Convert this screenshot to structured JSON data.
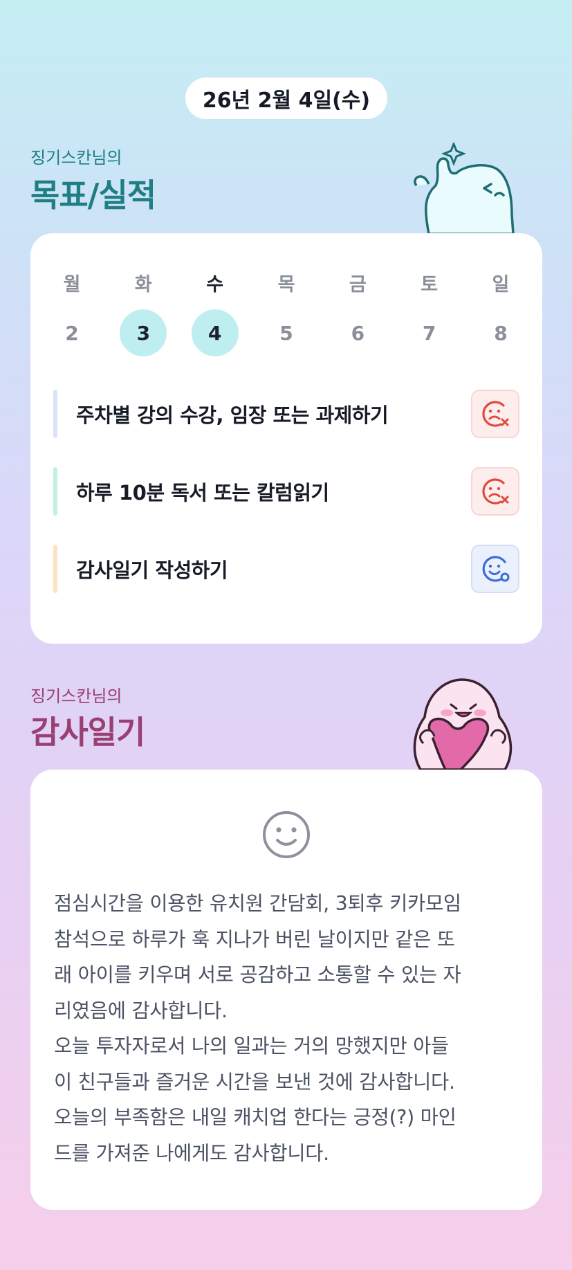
{
  "header": {
    "date": "26년 2월 4일(수)"
  },
  "goals_section": {
    "subtitle": "징기스칸님의",
    "title": "목표/실적",
    "week": {
      "days": [
        "월",
        "화",
        "수",
        "목",
        "금",
        "토",
        "일"
      ],
      "dates": [
        "2",
        "3",
        "4",
        "5",
        "6",
        "7",
        "8"
      ],
      "highlighted": [
        "3",
        "4"
      ],
      "today": "4"
    },
    "goals": [
      {
        "text": "주차별 강의 수강, 임장 또는 과제하기",
        "accent": "#dbe2fb",
        "status": "fail",
        "status_icon": "sad-face-x-icon"
      },
      {
        "text": "하루 10분 독서 또는 칼럼읽기",
        "accent": "#c4f0df",
        "status": "fail",
        "status_icon": "sad-face-x-icon"
      },
      {
        "text": "감사일기 작성하기",
        "accent": "#fde2c2",
        "status": "done",
        "status_icon": "smile-face-check-icon"
      }
    ]
  },
  "diary_section": {
    "subtitle": "징기스칸님의",
    "title": "감사일기",
    "mood_icon": "smile-face-icon",
    "lines": [
      "점심시간을 이용한 유치원 간담회, 3퇴후 키카모임",
      "참석으로 하루가 훅 지나가 버린 날이지만 같은 또",
      "래 아이를 키우며 서로 공감하고 소통할 수 있는 자",
      "리였음에 감사합니다.",
      "오늘 투자자로서 나의 일과는 거의 망했지만 아들",
      "이 친구들과 즐거운 시간을 보낸 것에 감사합니다.",
      "오늘의 부족함은 내일 캐치업 한다는 긍정(?) 마인",
      "드를 가져준 나에게도 감사합니다."
    ]
  },
  "colors": {
    "title_teal": "#1e7e83",
    "title_plum": "#9a3f72",
    "highlight_date": "#bfeef1",
    "fail_icon": "#e0493c",
    "done_icon": "#3d6bd8"
  }
}
